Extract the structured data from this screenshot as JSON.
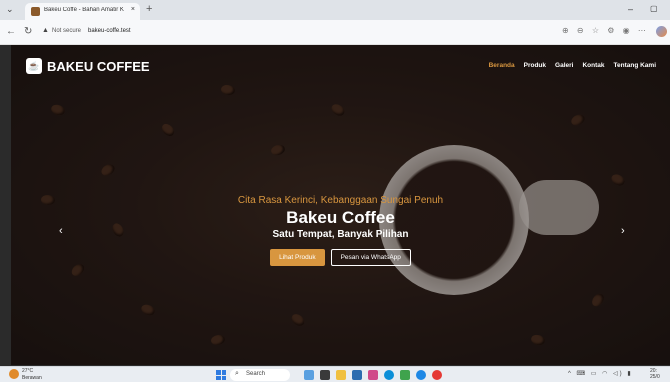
{
  "browser": {
    "tab_title": "Bakeu Coffe - Bahan Amatir Kulin",
    "tab_close": "×",
    "new_tab": "+",
    "not_secure": "Not secure",
    "url": "bakeu-coffe.test",
    "window_min": "–",
    "window_max": "▢"
  },
  "site": {
    "brand": "BAKEU COFFEE",
    "nav": [
      "Beranda",
      "Produk",
      "Galeri",
      "Kontak",
      "Tentang Kami"
    ],
    "active_nav": "Beranda",
    "hero": {
      "tagline": "Cita Rasa Kerinci, Kebanggaan Sungai Penuh",
      "title": "Bakeu Coffee",
      "subtitle": "Satu Tempat, Banyak Pilihan",
      "primary_button": "Lihat Produk",
      "secondary_button": "Pesan via WhatsApp"
    },
    "arrows": {
      "prev": "‹",
      "next": "›"
    },
    "colors": {
      "accent": "#d8963f",
      "text": "#ffffff"
    }
  },
  "taskbar": {
    "weather_temp": "27°C",
    "weather_desc": "Berawan",
    "search": "Search",
    "clock_time": "20:",
    "clock_date": "25/0"
  }
}
